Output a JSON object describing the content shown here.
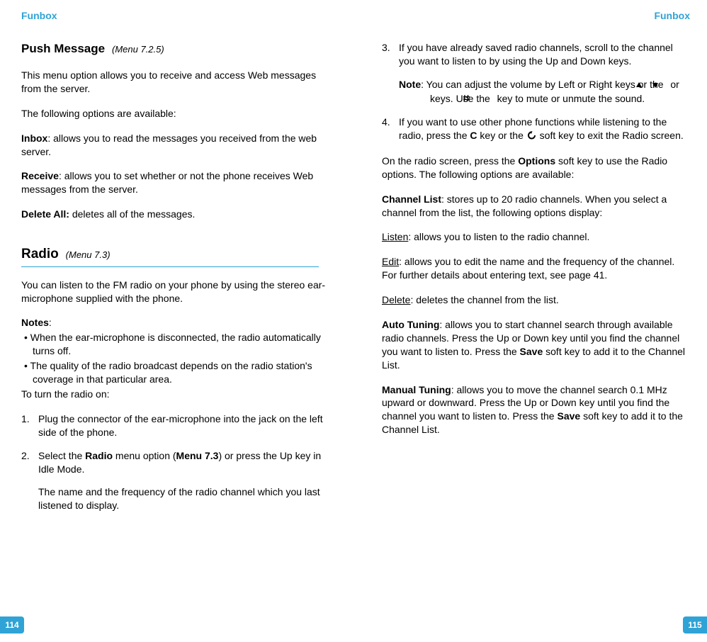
{
  "header": {
    "left": "Funbox",
    "right": "Funbox"
  },
  "pageNumbers": {
    "left": "114",
    "right": "115"
  },
  "left": {
    "push": {
      "title": "Push Message",
      "menu": "(Menu 7.2.5)",
      "intro": "This menu option allows you to receive and access Web messages from the server.",
      "following": "The following options are available:",
      "inboxLabel": "Inbox",
      "inboxText": ": allows you to read the messages you received from the web server.",
      "receiveLabel": "Receive",
      "receiveText": ": allows you to set whether or not the phone receives Web messages from the server.",
      "deleteAllLabel": "Delete All:",
      "deleteAllText": " deletes all of the messages."
    },
    "radio": {
      "title": "Radio",
      "menu": "(Menu 7.3)",
      "intro": "You can listen to the FM radio on your phone by using the stereo ear-microphone supplied with the phone.",
      "notesLabel": "Notes",
      "notesColon": ":",
      "note1": "When the ear-microphone is disconnected, the radio automatically turns off.",
      "note2": "The quality of the radio broadcast depends on the radio station's coverage in that particular area.",
      "toTurnOn": "To turn the radio on:",
      "step1num": "1.",
      "step1": "Plug the connector of the ear-microphone into the jack on the left side of the phone.",
      "step2num": "2.",
      "step2a": "Select the ",
      "step2radio": "Radio",
      "step2b": " menu option (",
      "step2menu": "Menu 7.3",
      "step2c": ") or press the Up key in Idle Mode.",
      "step2sub": "The name and the frequency of the radio channel which you last listened to display."
    }
  },
  "right": {
    "step3num": "3.",
    "step3": "If you have already saved radio channels, scroll to the channel you want to listen to by using the Up and Down keys.",
    "noteLabel": "Note",
    "noteA": ": You can adjust the volume by Left or Right keys or the ",
    "noteB": " or ",
    "noteC": " keys. Use the ",
    "noteD": " key to mute or unmute the sound.",
    "step4num": "4.",
    "step4a": "If you want to use other phone functions while listening to the radio, press the ",
    "step4C": "C",
    "step4b": " key or the ",
    "step4c": " soft key to exit the Radio screen.",
    "onRadioA": "On the radio screen, press the ",
    "onRadioOptions": "Options",
    "onRadioB": " soft key to use the Radio options. The following options are available:",
    "channelListLabel": "Channel List",
    "channelListText": ": stores up to 20 radio channels. When you select a channel from the list, the following options display:",
    "listenLabel": "Listen",
    "listenText": ": allows you to listen to the radio channel.",
    "editLabel": "Edit",
    "editText": ": allows you to edit the name and the frequency of the channel. For further details about entering text, see page 41.",
    "deleteLabel": "Delete",
    "deleteText": ": deletes the channel from the list.",
    "autoLabel": "Auto Tuning",
    "autoTextA": ": allows you to start channel search through available radio channels. Press the Up or Down key until you find the channel you want to listen to. Press the ",
    "autoSave": "Save",
    "autoTextB": " soft key to add it to the Channel List.",
    "manualLabel": "Manual Tuning",
    "manualTextA": ": allows you to move the channel search 0.1 MHz upward or downward. Press the Up or Down key until you find the channel you want to listen to. Press the ",
    "manualSave": "Save",
    "manualTextB": " soft key to add it to the Channel List."
  }
}
